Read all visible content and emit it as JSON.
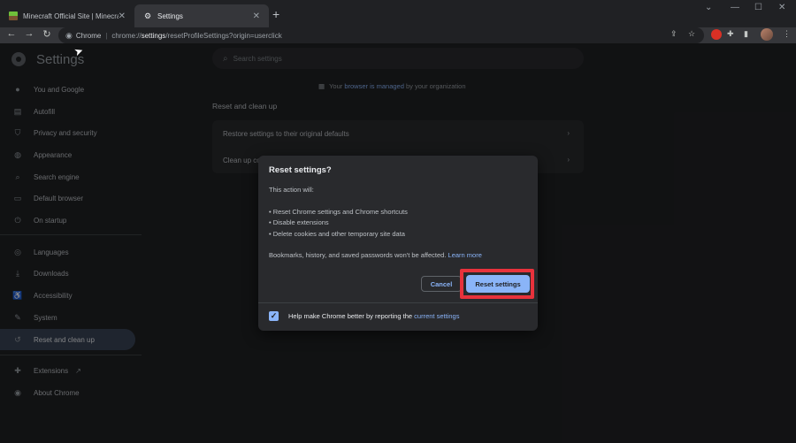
{
  "tabs": [
    {
      "title": "Minecraft Official Site | Minecraft"
    },
    {
      "title": "Settings"
    }
  ],
  "toolbar": {
    "chip": "Chrome",
    "url_prefix": "chrome://",
    "url_bold": "settings",
    "url_rest": "/resetProfileSettings?origin=userclick"
  },
  "page": {
    "title": "Settings",
    "search_placeholder": "Search settings",
    "managed_pre": "Your",
    "managed_link": "browser is managed",
    "managed_post": "by your organization",
    "section_title": "Reset and clean up",
    "row_restore": "Restore settings to their original defaults",
    "row_cleanup": "Clean up co"
  },
  "sidebar": {
    "items": [
      {
        "label": "You and Google",
        "icon": "person-icon"
      },
      {
        "label": "Autofill",
        "icon": "clipboard-icon"
      },
      {
        "label": "Privacy and security",
        "icon": "shield-icon"
      },
      {
        "label": "Appearance",
        "icon": "palette-icon"
      },
      {
        "label": "Search engine",
        "icon": "search-icon"
      },
      {
        "label": "Default browser",
        "icon": "browser-icon"
      },
      {
        "label": "On startup",
        "icon": "power-icon"
      },
      {
        "label": "Languages",
        "icon": "globe-icon"
      },
      {
        "label": "Downloads",
        "icon": "download-icon"
      },
      {
        "label": "Accessibility",
        "icon": "accessibility-icon"
      },
      {
        "label": "System",
        "icon": "wrench-icon"
      },
      {
        "label": "Reset and clean up",
        "icon": "history-icon"
      },
      {
        "label": "Extensions",
        "icon": "puzzle-icon"
      },
      {
        "label": "About Chrome",
        "icon": "chrome-icon"
      }
    ]
  },
  "dialog": {
    "title": "Reset settings?",
    "intro": "This action will:",
    "bullet1": "• Reset Chrome settings and Chrome shortcuts",
    "bullet2": "• Disable extensions",
    "bullet3": "• Delete cookies and other temporary site data",
    "note": "Bookmarks, history, and saved passwords won't be affected.",
    "learn_more": "Learn more",
    "cancel_label": "Cancel",
    "reset_label": "Reset settings",
    "check_label": "Help make Chrome better by reporting the",
    "check_link": "current settings",
    "checked": true
  },
  "colors": {
    "accent": "#8ab4f8",
    "highlight": "#e8323c",
    "background": "#202124"
  }
}
